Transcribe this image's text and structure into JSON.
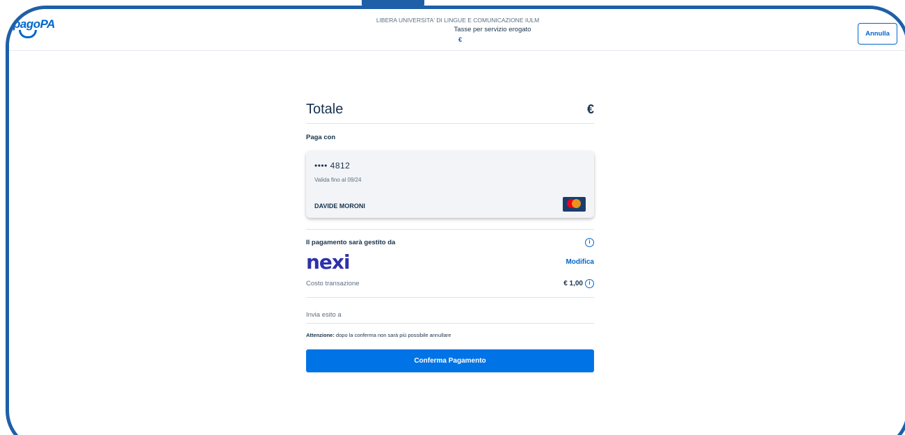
{
  "header": {
    "logo_text": "pagoPA",
    "organization": "LIBERA UNIVERSITA' DI LINGUE E COMUNICAZIONE IULM",
    "description": "Tasse per servizio erogato",
    "amount": "€",
    "cancel_label": "Annulla"
  },
  "summary": {
    "total_label": "Totale",
    "total_amount": "€",
    "pay_with_label": "Paga con"
  },
  "card": {
    "number": "•••• 4812",
    "expiry": "Valida fino al 09/24",
    "holder": "DAVIDE MORONI",
    "brand_icon": "mastercard-icon"
  },
  "psp": {
    "managed_by_label": "Il pagamento sarà gestito da",
    "name": "nexi",
    "modify_label": "Modifica",
    "fee_label": "Costo transazione",
    "fee_value": "€ 1,00"
  },
  "email": {
    "placeholder": "Invia esito a"
  },
  "warning": {
    "bold": "Attenzione:",
    "text": " dopo la conferma non sarà più possibile annullare"
  },
  "confirm_label": "Conferma Pagamento",
  "colors": {
    "accent": "#0066cc",
    "button": "#0073e6",
    "frame": "#1e5fa8",
    "nexi": "#2d32aa"
  }
}
